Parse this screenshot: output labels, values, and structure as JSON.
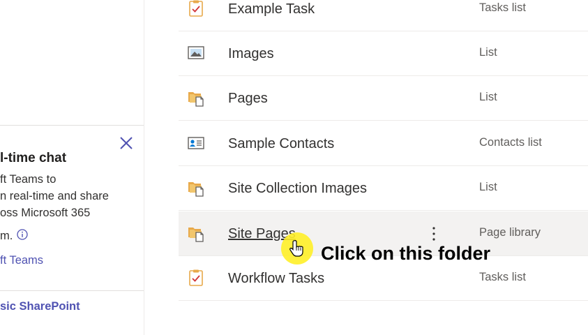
{
  "teams_card": {
    "title_partial": "l-time chat",
    "line1": "ft Teams to",
    "line2": "n real-time and share",
    "line3": "oss Microsoft 365",
    "line4": "m.",
    "link": "ft Teams",
    "close_icon": "close-icon",
    "info_icon": "info-icon"
  },
  "classic_link": "sic SharePoint",
  "rows": [
    {
      "name": "Example Task",
      "type": "Tasks list",
      "icon": "task-list-icon"
    },
    {
      "name": "Images",
      "type": "List",
      "icon": "picture-list-icon"
    },
    {
      "name": "Pages",
      "type": "List",
      "icon": "library-icon"
    },
    {
      "name": "Sample Contacts",
      "type": "Contacts list",
      "icon": "contacts-list-icon"
    },
    {
      "name": "Site Collection Images",
      "type": "List",
      "icon": "library-icon"
    },
    {
      "name": "Site Pages",
      "type": "Page library",
      "icon": "library-icon",
      "hovered": true
    },
    {
      "name": "Workflow Tasks",
      "type": "Tasks list",
      "icon": "task-list-icon"
    }
  ],
  "callout": "Click on this folder",
  "colors": {
    "link": "#4f52b2",
    "hover_row": "#f3f2f1",
    "highlight": "#fff028",
    "icon_orange": "#e8a94a"
  }
}
